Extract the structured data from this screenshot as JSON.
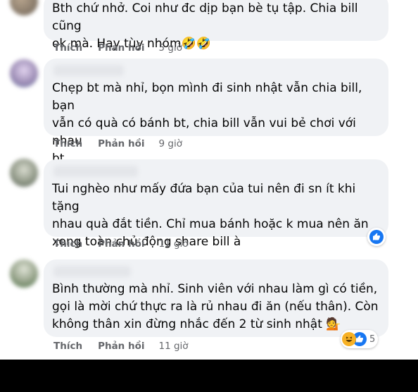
{
  "comments": [
    {
      "text": "Bth chứ nhở. Coi như đc dịp bạn bè tụ tập. Chia bill cũng\nok mà. Hay tùy nhóm🤣🤣",
      "like": "Thích",
      "reply": "Phản hồi",
      "time": "5 giờ"
    },
    {
      "text": "Chẹp bt mà nhỉ, bọn mình đi sinh nhật vẫn chia bill, bạn\nvẫn có quà có bánh bt, chia bill vẫn vui bẻ chơi với nhau\nbt",
      "like": "Thích",
      "reply": "Phản hồi",
      "time": "9 giờ"
    },
    {
      "text": "Tui nghèo như mấy đứa bạn của tui nên đi sn ít khi tặng\nnhau quà đắt tiền. Chỉ mua bánh hoặc k mua nên ăn\nxong toàn chủ động share bill à",
      "like": "Thích",
      "reply": "Phản hồi",
      "time": "11 giờ",
      "reactions": {
        "icons": [
          "like-icon"
        ]
      }
    },
    {
      "text": "Bình thường mà nhỉ. Sinh viên với nhau làm gì có tiền,\ngọi là mời chứ thực ra là rủ nhau đi ăn (nếu thân). Còn\nkhông thân xin đừng nhắc đến 2 từ sinh nhật 💁",
      "like": "Thích",
      "reply": "Phản hồi",
      "time": "11 giờ",
      "reactions": {
        "icons": [
          "haha-icon",
          "like-icon"
        ],
        "count": "5"
      }
    }
  ],
  "colors": {
    "bubble": "#f0f2f5",
    "secondary_text": "#65676b",
    "like_blue": "#1877f2",
    "haha_yellow": "#f7b125"
  }
}
